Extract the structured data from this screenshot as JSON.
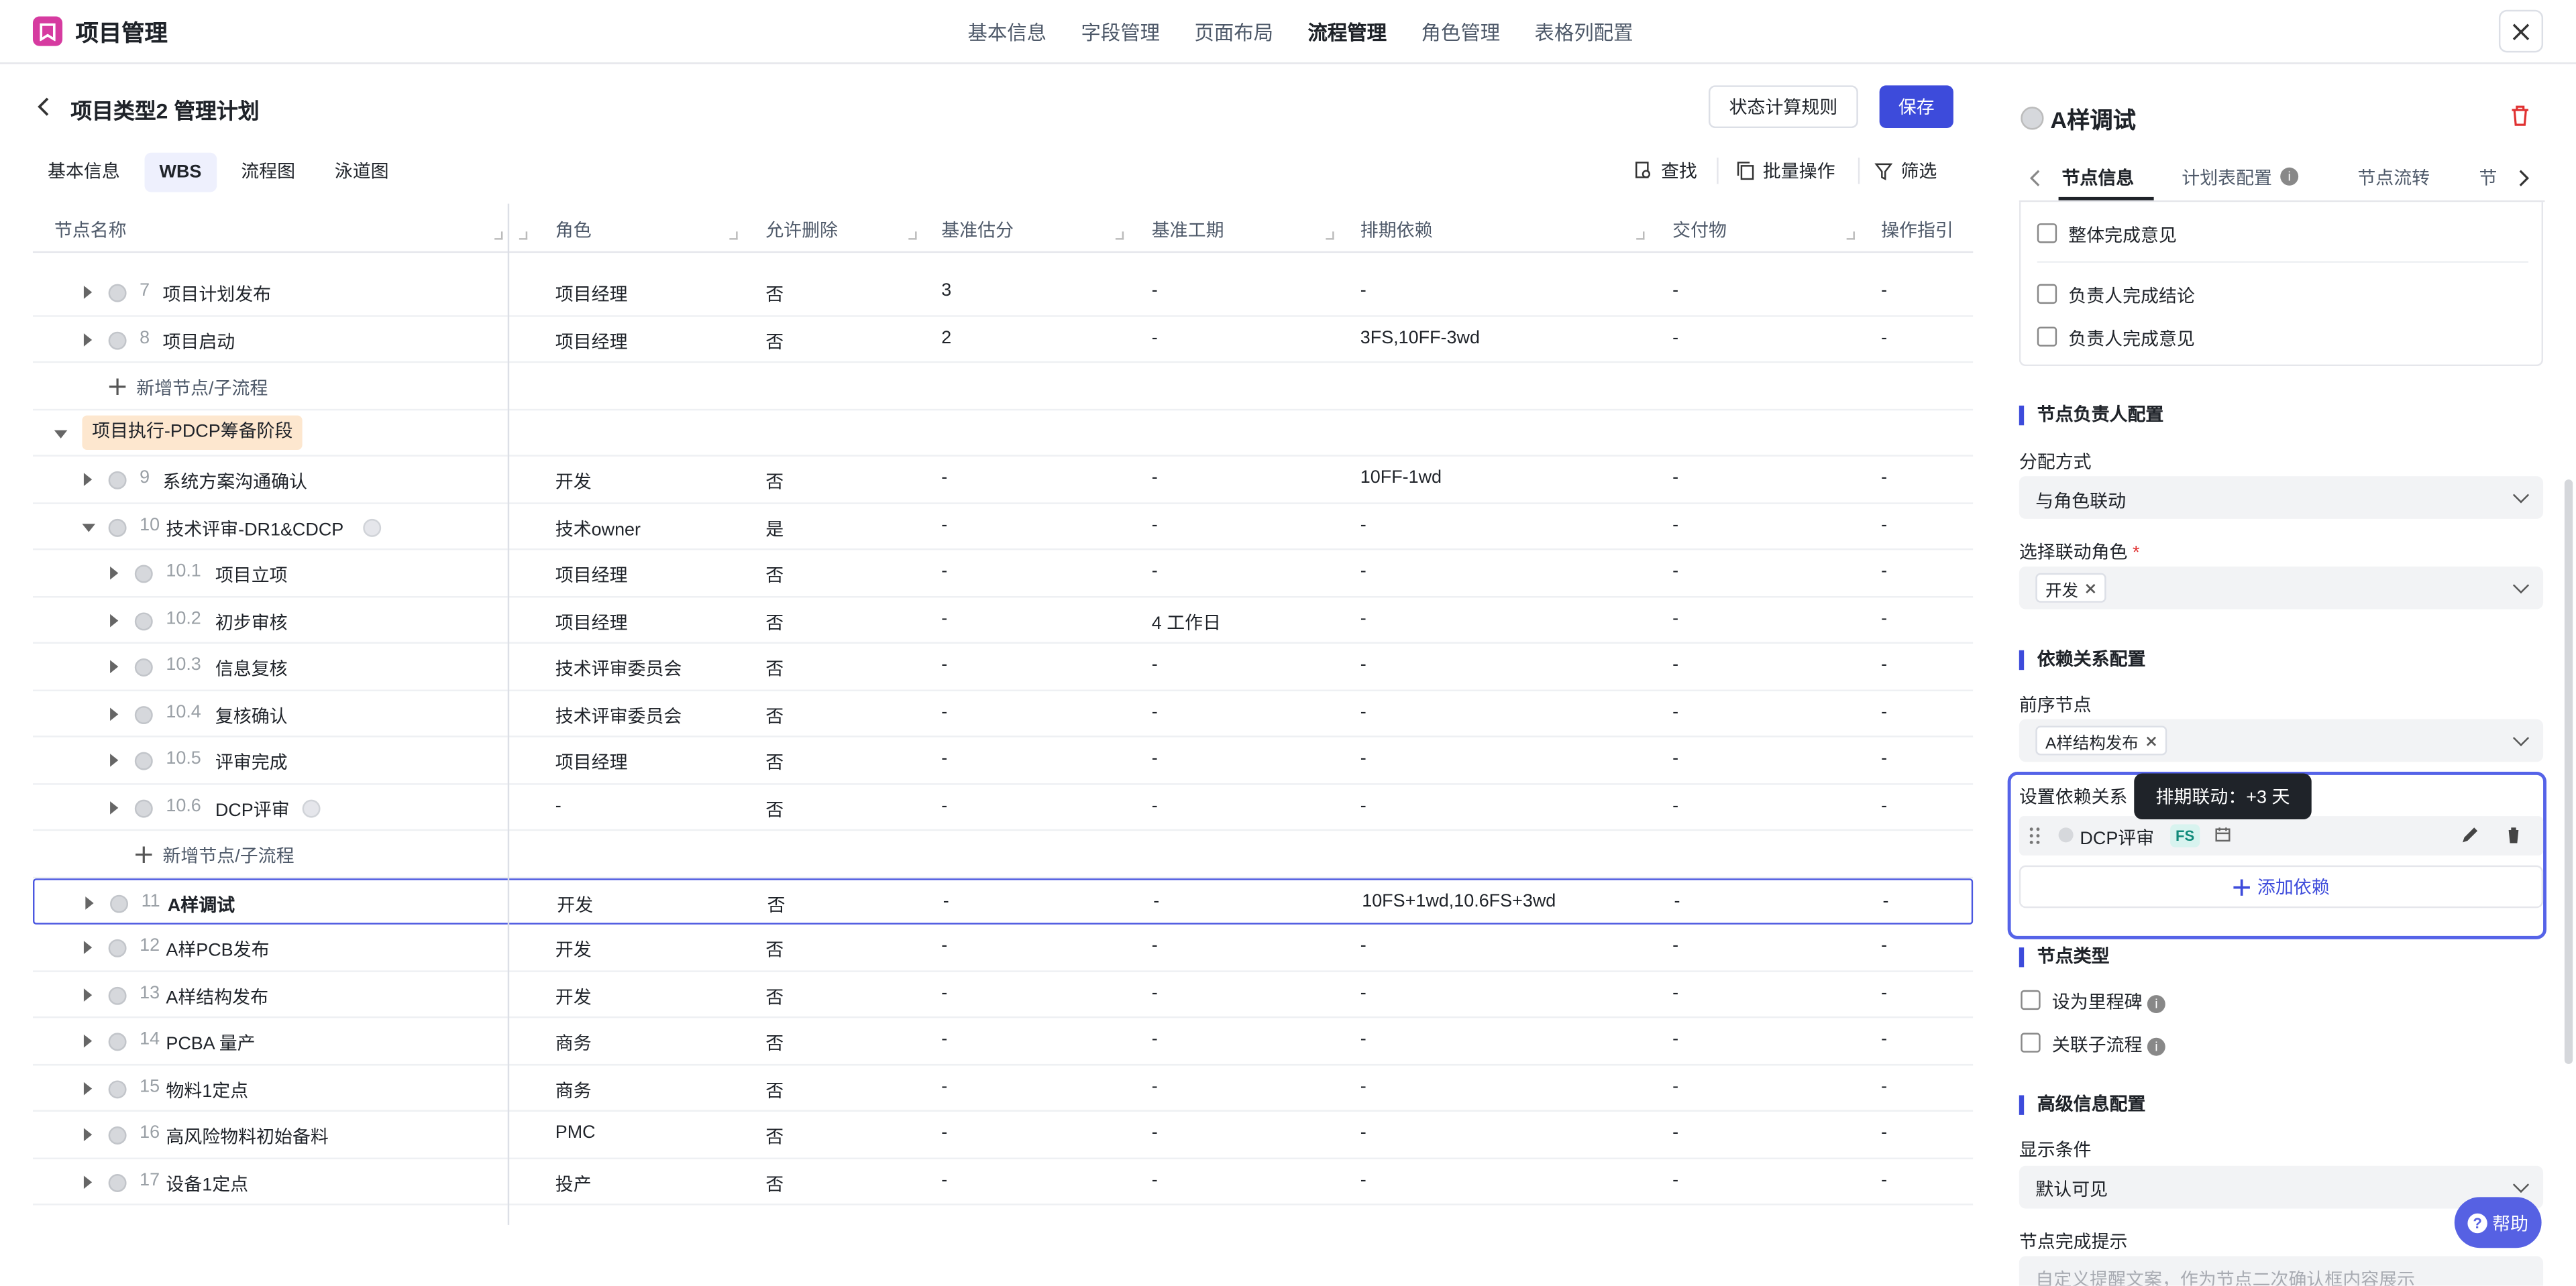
{
  "app": {
    "title": "项目管理",
    "nav": [
      "基本信息",
      "字段管理",
      "页面布局",
      "流程管理",
      "角色管理",
      "表格列配置"
    ],
    "nav_active": "流程管理"
  },
  "page": {
    "title": "项目类型2 管理计划",
    "btn_rule": "状态计算规则",
    "btn_save": "保存",
    "tabs": [
      "基本信息",
      "WBS",
      "流程图",
      "泳道图"
    ],
    "tab_active": "WBS",
    "tools": {
      "find": "查找",
      "batch": "批量操作",
      "filter": "筛选"
    }
  },
  "table": {
    "columns": [
      "节点名称",
      "角色",
      "允许删除",
      "基准估分",
      "基准工期",
      "排期依赖",
      "交付物",
      "操作指引"
    ],
    "rows": [
      {
        "kind": "node",
        "level": 0,
        "num": "7",
        "name": "项目计划发布",
        "role": "项目经理",
        "del": "否",
        "est": "3",
        "dur": "-",
        "dep": "-",
        "deliv": "-",
        "guide": "-"
      },
      {
        "kind": "node",
        "level": 0,
        "num": "8",
        "name": "项目启动",
        "role": "项目经理",
        "del": "否",
        "est": "2",
        "dur": "-",
        "dep": "3FS,10FF-3wd",
        "deliv": "-",
        "guide": "-"
      },
      {
        "kind": "add",
        "level": 0,
        "name": "新增节点/子流程"
      },
      {
        "kind": "phase",
        "name": "项目执行-PDCP筹备阶段"
      },
      {
        "kind": "node",
        "level": 0,
        "num": "9",
        "name": "系统方案沟通确认",
        "role": "开发",
        "del": "否",
        "est": "-",
        "dur": "-",
        "dep": "10FF-1wd",
        "deliv": "-",
        "guide": "-"
      },
      {
        "kind": "node",
        "level": 0,
        "num": "10",
        "name": "技术评审-DR1&CDCP",
        "role": "技术owner",
        "del": "是",
        "est": "-",
        "dur": "-",
        "dep": "-",
        "deliv": "-",
        "guide": "-",
        "expanded": true,
        "link": true
      },
      {
        "kind": "node",
        "level": 1,
        "num": "10.1",
        "name": "项目立项",
        "role": "项目经理",
        "del": "否",
        "est": "-",
        "dur": "-",
        "dep": "-",
        "deliv": "-",
        "guide": "-"
      },
      {
        "kind": "node",
        "level": 1,
        "num": "10.2",
        "name": "初步审核",
        "role": "项目经理",
        "del": "否",
        "est": "-",
        "dur": "4 工作日",
        "dep": "-",
        "deliv": "-",
        "guide": "-"
      },
      {
        "kind": "node",
        "level": 1,
        "num": "10.3",
        "name": "信息复核",
        "role": "技术评审委员会",
        "del": "否",
        "est": "-",
        "dur": "-",
        "dep": "-",
        "deliv": "-",
        "guide": "-"
      },
      {
        "kind": "node",
        "level": 1,
        "num": "10.4",
        "name": "复核确认",
        "role": "技术评审委员会",
        "del": "否",
        "est": "-",
        "dur": "-",
        "dep": "-",
        "deliv": "-",
        "guide": "-"
      },
      {
        "kind": "node",
        "level": 1,
        "num": "10.5",
        "name": "评审完成",
        "role": "项目经理",
        "del": "否",
        "est": "-",
        "dur": "-",
        "dep": "-",
        "deliv": "-",
        "guide": "-"
      },
      {
        "kind": "node",
        "level": 1,
        "num": "10.6",
        "name": "DCP评审",
        "role": "-",
        "del": "否",
        "est": "-",
        "dur": "-",
        "dep": "-",
        "deliv": "-",
        "guide": "-",
        "link": true
      },
      {
        "kind": "add",
        "level": 1,
        "name": "新增节点/子流程"
      },
      {
        "kind": "node",
        "level": 0,
        "num": "11",
        "name": "A样调试",
        "role": "开发",
        "del": "否",
        "est": "-",
        "dur": "-",
        "dep": "10FS+1wd,10.6FS+3wd",
        "deliv": "-",
        "guide": "-",
        "selected": true
      },
      {
        "kind": "node",
        "level": 0,
        "num": "12",
        "name": "A样PCB发布",
        "role": "开发",
        "del": "否",
        "est": "-",
        "dur": "-",
        "dep": "-",
        "deliv": "-",
        "guide": "-"
      },
      {
        "kind": "node",
        "level": 0,
        "num": "13",
        "name": "A样结构发布",
        "role": "开发",
        "del": "否",
        "est": "-",
        "dur": "-",
        "dep": "-",
        "deliv": "-",
        "guide": "-"
      },
      {
        "kind": "node",
        "level": 0,
        "num": "14",
        "name": "PCBA 量产",
        "role": "商务",
        "del": "否",
        "est": "-",
        "dur": "-",
        "dep": "-",
        "deliv": "-",
        "guide": "-"
      },
      {
        "kind": "node",
        "level": 0,
        "num": "15",
        "name": "物料1定点",
        "role": "商务",
        "del": "否",
        "est": "-",
        "dur": "-",
        "dep": "-",
        "deliv": "-",
        "guide": "-"
      },
      {
        "kind": "node",
        "level": 0,
        "num": "16",
        "name": "高风险物料初始备料",
        "role": "PMC",
        "del": "否",
        "est": "-",
        "dur": "-",
        "dep": "-",
        "deliv": "-",
        "guide": "-"
      },
      {
        "kind": "node",
        "level": 0,
        "num": "17",
        "name": "设备1定点",
        "role": "投产",
        "del": "否",
        "est": "-",
        "dur": "-",
        "dep": "-",
        "deliv": "-",
        "guide": "-"
      }
    ]
  },
  "panel": {
    "title": "A样调试",
    "tabs": [
      "节点信息",
      "计划表配置",
      "节点流转",
      "节"
    ],
    "tab_active": "节点信息",
    "complete_opts": [
      "整体完成意见",
      "负责人完成结论",
      "负责人完成意见"
    ],
    "owner": {
      "section": "节点负责人配置",
      "assign_label": "分配方式",
      "assign_value": "与角色联动",
      "role_label": "选择联动角色",
      "required_mark": "*",
      "role_tag": "开发"
    },
    "dep": {
      "section": "依赖关系配置",
      "pre_label": "前序节点",
      "pre_tag": "A样结构发布",
      "set_label": "设置依赖关系",
      "tooltip": "排期联动：+3 天",
      "item_name": "DCP评审",
      "item_type": "FS",
      "add": "添加依赖"
    },
    "type": {
      "section": "节点类型",
      "milestone": "设为里程碑",
      "subflow": "关联子流程"
    },
    "adv": {
      "section": "高级信息配置",
      "cond_label": "显示条件",
      "cond_value": "默认可见",
      "hint_label": "节点完成提示",
      "hint_placeholder": "自定义提醒文案，作为节点二次确认框内容展示"
    }
  },
  "help": "帮助"
}
